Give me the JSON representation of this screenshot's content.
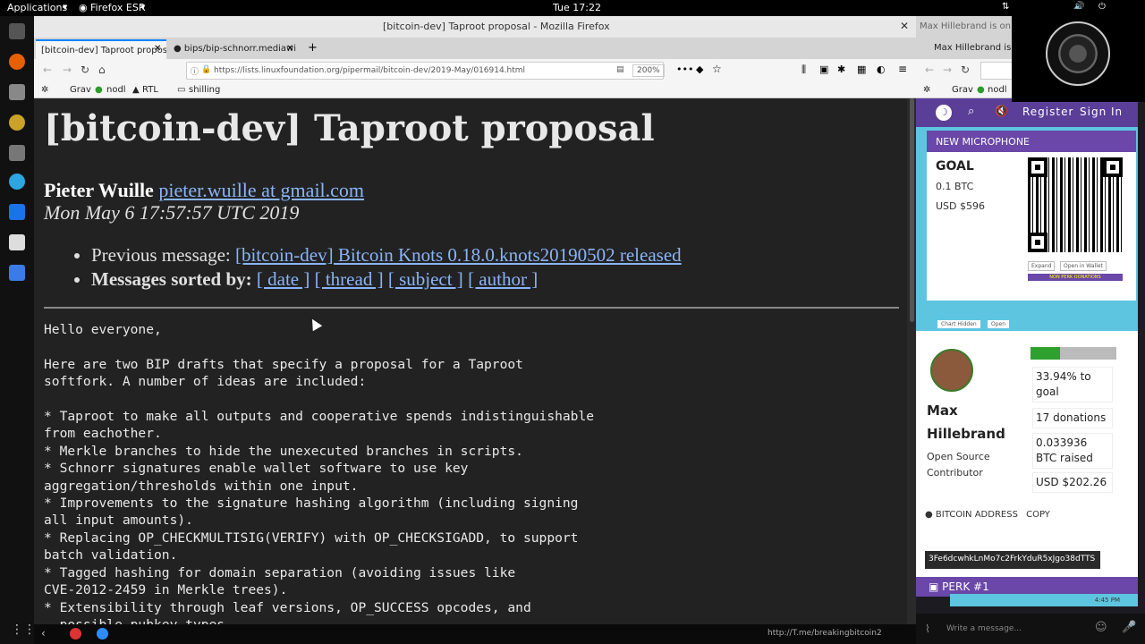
{
  "topbar": {
    "applications": "Applications",
    "firefox": "Firefox ESR",
    "clock": "Tue 17:22"
  },
  "window": {
    "title": "[bitcoin-dev] Taproot proposal - Mozilla Firefox"
  },
  "tabs": [
    {
      "label": "[bitcoin-dev] Taproot propos"
    },
    {
      "label": "bips/bip-schnorr.mediawi"
    }
  ],
  "url": {
    "full": "https://lists.linuxfoundation.org/pipermail/bitcoin-dev/2019-May/016914.html",
    "zoom": "200%"
  },
  "bookmarks": [
    "Grav",
    "nodl",
    "RTL",
    "shilling"
  ],
  "page": {
    "title": "[bitcoin-dev] Taproot proposal",
    "author_name": "Pieter Wuille",
    "author_email": "pieter.wuille at gmail.com",
    "date": "Mon May 6 17:57:57 UTC 2019",
    "prev_label": "Previous message:",
    "prev_link": "[bitcoin-dev] Bitcoin Knots 0.18.0.knots20190502 released",
    "sorted_label": "Messages sorted by:",
    "sort_date": "[ date ]",
    "sort_thread": "[ thread ]",
    "sort_subject": "[ subject ]",
    "sort_author": "[ author ]",
    "body": "Hello everyone,\n\nHere are two BIP drafts that specify a proposal for a Taproot\nsoftfork. A number of ideas are included:\n\n* Taproot to make all outputs and cooperative spends indistinguishable\nfrom eachother.\n* Merkle branches to hide the unexecuted branches in scripts.\n* Schnorr signatures enable wallet software to use key\naggregation/thresholds within one input.\n* Improvements to the signature hashing algorithm (including signing\nall input amounts).\n* Replacing OP_CHECKMULTISIG(VERIFY) with OP_CHECKSIGADD, to support\nbatch validation.\n* Tagged hashing for domain separation (avoiding issues like\nCVE-2012-2459 in Merkle trees).\n* Extensibility through leaf versions, OP_SUCCESS opcodes, and\n  possible pubkey types."
  },
  "right": {
    "tab1": "Max Hillebrand is on Ta",
    "tab2": "Max Hillebrand is on Ta",
    "bookmarks": [
      "Grav",
      "nodl"
    ],
    "register": "Register",
    "signin": "Sign In",
    "mic_title": "NEW MICROPHONE",
    "goal_label": "GOAL",
    "goal_btc": "0.1 BTC",
    "goal_usd": "USD $596",
    "expand": "Expand",
    "open_wallet": "Open in Wallet",
    "non_perk": "NON PERK DONATIONS",
    "chart_hidden": "Chart Hidden",
    "open": "Open",
    "progress": 0.3394,
    "pct_goal": "33.94% to goal",
    "donations": "17 donations",
    "btc_raised": "0.033936 BTC raised",
    "usd_raised": "USD $202.26",
    "name": "Max Hillebrand",
    "role": "Open Source Contributor",
    "addr_label": "BITCOIN ADDRESS",
    "copy": "COPY",
    "address": "3Fe6dcwhkLnMo7c2FrkYduR5xJgo38dTTS",
    "perk": "PERK #1",
    "chat_time": "4:45 PM",
    "chat_placeholder": "Write a message...",
    "status_url": "http://T.me/breakingbitcoin2"
  },
  "colors": {
    "link": "#8ab4f8",
    "accent_purple": "#6a47a8",
    "widget_bg": "#5ec5e0",
    "progress_green": "#2ea02e"
  }
}
